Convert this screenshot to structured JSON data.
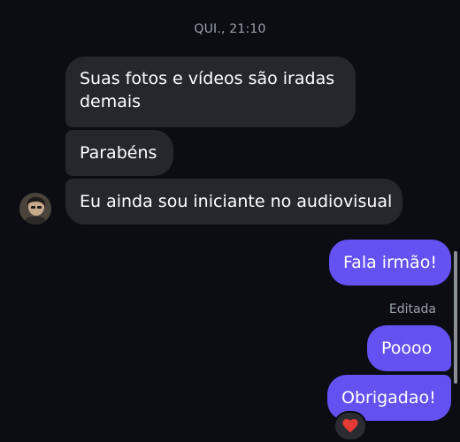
{
  "header": {
    "timestamp": "QUI., 21:10"
  },
  "incoming": [
    {
      "text": "Suas fotos e vídeos são iradas\ndemais"
    },
    {
      "text": "Parabéns"
    },
    {
      "text": "Eu ainda sou iniciante no audiovisual"
    }
  ],
  "outgoing": [
    {
      "text": "Fala irmão!"
    },
    {
      "text": "Poooo"
    },
    {
      "text": "Obrigadao!"
    }
  ],
  "edited_label": "Editada",
  "reaction": {
    "icon": "heart-icon",
    "color": "#e53935"
  },
  "colors": {
    "background": "#0b0d12",
    "incoming_bubble": "#25272d",
    "outgoing_bubble": "#6451f2"
  }
}
